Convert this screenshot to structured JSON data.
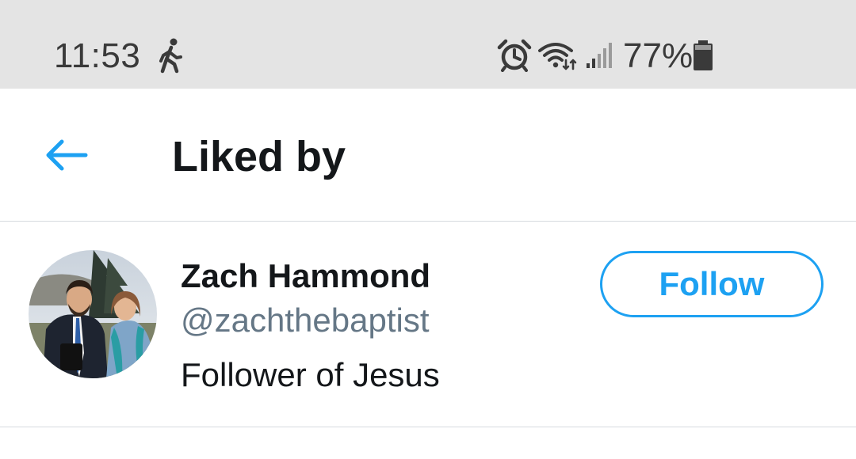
{
  "status_bar": {
    "time": "11:53",
    "battery_percent": "77%",
    "icons": [
      "walk-icon",
      "alarm-icon",
      "wifi-icon",
      "signal-icon",
      "battery-icon"
    ]
  },
  "header": {
    "title": "Liked by",
    "back_icon": "back-arrow-icon"
  },
  "users": [
    {
      "name": "Zach Hammond",
      "handle": "@zachthebaptist",
      "bio": "Follower of Jesus",
      "follow_label": "Follow"
    }
  ],
  "colors": {
    "accent": "#1da1f2",
    "text_primary": "#14171a",
    "text_secondary": "#657786",
    "status_bar_bg": "#e4e4e4",
    "divider": "#d6dadf"
  }
}
